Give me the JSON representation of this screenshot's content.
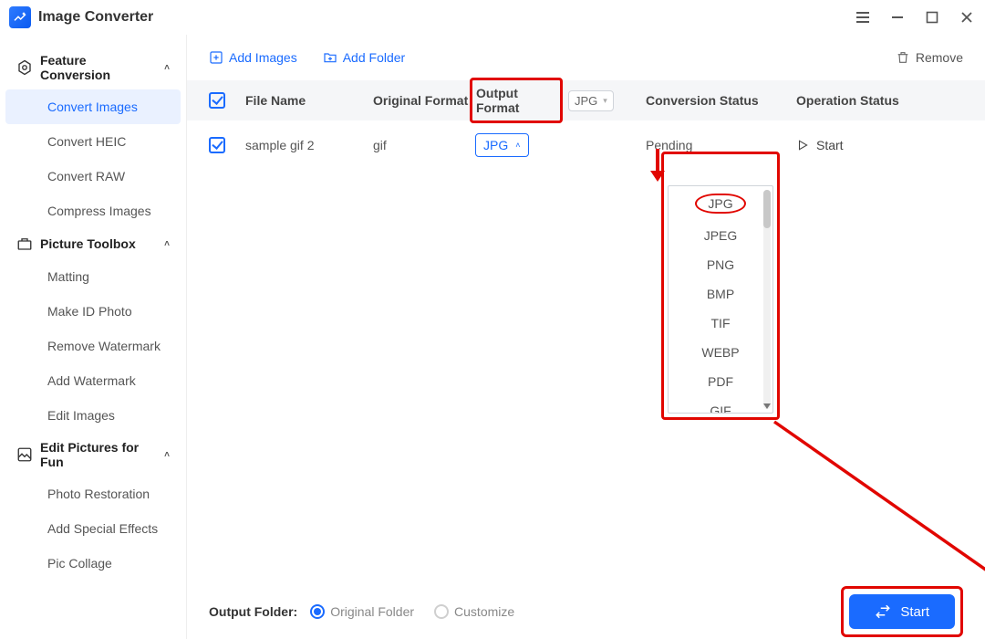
{
  "app": {
    "title": "Image Converter"
  },
  "sidebar": {
    "groups": [
      {
        "label": "Feature Conversion",
        "items": [
          "Convert Images",
          "Convert HEIC",
          "Convert RAW",
          "Compress Images"
        ]
      },
      {
        "label": "Picture Toolbox",
        "items": [
          "Matting",
          "Make ID Photo",
          "Remove Watermark",
          "Add Watermark",
          "Edit Images"
        ]
      },
      {
        "label": "Edit Pictures for Fun",
        "items": [
          "Photo Restoration",
          "Add Special Effects",
          "Pic Collage"
        ]
      }
    ],
    "active": "Convert Images"
  },
  "toolbar": {
    "add_images": "Add Images",
    "add_folder": "Add Folder",
    "remove": "Remove"
  },
  "columns": {
    "file_name": "File Name",
    "original_format": "Original Format",
    "output_format": "Output Format",
    "output_format_select": "JPG",
    "conversion_status": "Conversion Status",
    "operation_status": "Operation Status"
  },
  "rows": [
    {
      "file_name": "sample gif 2",
      "original_format": "gif",
      "output_format": "JPG",
      "status": "Pending",
      "action": "Start"
    }
  ],
  "dropdown": {
    "options": [
      "JPG",
      "JPEG",
      "PNG",
      "BMP",
      "TIF",
      "WEBP",
      "PDF",
      "GIF"
    ]
  },
  "footer": {
    "label": "Output Folder:",
    "opt_original": "Original Folder",
    "opt_customize": "Customize",
    "start": "Start"
  }
}
